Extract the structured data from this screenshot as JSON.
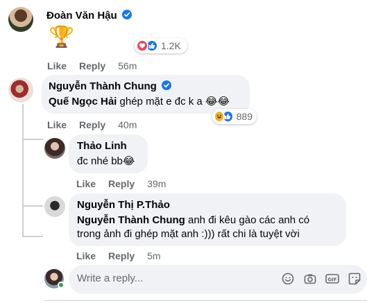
{
  "comments": [
    {
      "author": "Đoàn Văn Hậu",
      "verified": true,
      "body_emoji": "🏆",
      "reactions": {
        "icons": [
          "love",
          "like"
        ],
        "count": "1.2K"
      },
      "actions": {
        "like": "Like",
        "reply": "Reply",
        "time": "56m"
      }
    },
    {
      "author": "Nguyễn Thành Chung",
      "verified": true,
      "mention": "Quế Ngọc Hải",
      "text": " ghép mặt e đc k a 😂😂",
      "reactions": {
        "icons": [
          "haha",
          "like"
        ],
        "count": "889"
      },
      "actions": {
        "like": "Like",
        "reply": "Reply",
        "time": "40m"
      }
    }
  ],
  "replies": [
    {
      "author": "Thảo Linh",
      "text": "đc nhé bb😂",
      "actions": {
        "like": "Like",
        "reply": "Reply",
        "time": "39m"
      }
    },
    {
      "author": "Nguyễn Thị P.Thảo",
      "mention": "Nguyễn Thành Chung",
      "text_line1": " anh đi kêu gào các anh có",
      "text_line2": "trong ảnh đi ghép mặt anh :))) rất chi là tuyệt vời",
      "actions": {
        "like": "Like",
        "reply": "Reply",
        "time": "5m"
      }
    }
  ],
  "reply_box": {
    "placeholder": "Write a reply...",
    "icons": [
      "emoji-icon",
      "camera-icon",
      "gif-icon",
      "sticker-icon"
    ]
  },
  "colors": {
    "verified": "#1877f2",
    "bubble": "#f0f2f5",
    "secondary_text": "#65676b",
    "online": "#31a24c"
  }
}
